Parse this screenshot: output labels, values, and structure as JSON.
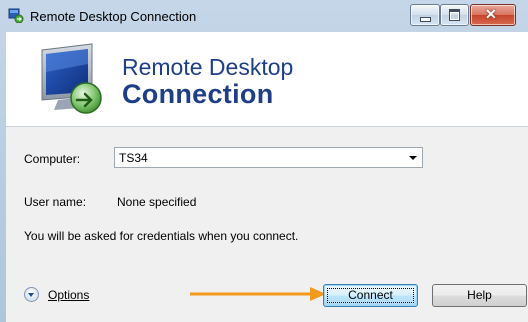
{
  "window": {
    "title": "Remote Desktop Connection"
  },
  "banner": {
    "line1": "Remote Desktop",
    "line2": "Connection"
  },
  "form": {
    "computer_label": "Computer:",
    "computer_value": "TS34",
    "username_label": "User name:",
    "username_value": "None specified",
    "info_text": "You will be asked for credentials when you connect."
  },
  "footer": {
    "options_label": "Options",
    "connect_label": "Connect",
    "help_label": "Help"
  },
  "colors": {
    "banner_text": "#1e3f87",
    "annotation_arrow": "#f39a1e"
  },
  "icons": {
    "app": "remote-desktop-icon",
    "options": "chevron-down-circle-icon"
  }
}
